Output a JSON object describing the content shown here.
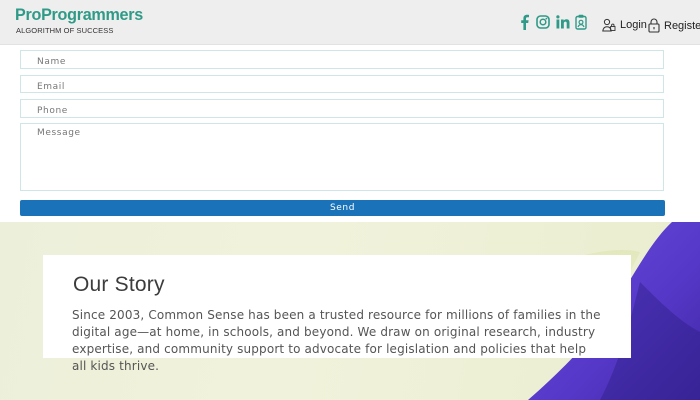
{
  "header": {
    "logo_title": "ProProgrammers",
    "logo_tagline": "ALGORITHM OF SUCCESS",
    "social": [
      "facebook-icon",
      "instagram-icon",
      "linkedin-icon",
      "clipboard-icon"
    ],
    "login_label": "Login",
    "register_label": "Register"
  },
  "form": {
    "name_placeholder": "Name",
    "email_placeholder": "Email",
    "phone_placeholder": "Phone",
    "message_placeholder": "Message",
    "send_label": "Send"
  },
  "story": {
    "title": "Our Story",
    "body": "Since 2003, Common Sense has been a trusted resource for millions of families in the digital age—at home, in schools, and beyond. We draw on original research, industry expertise, and community support to advocate for legislation and policies that help all kids thrive."
  },
  "colors": {
    "brand": "#2f9a87",
    "button": "#1a73b8",
    "accent_purple": "#5a3fd0"
  }
}
